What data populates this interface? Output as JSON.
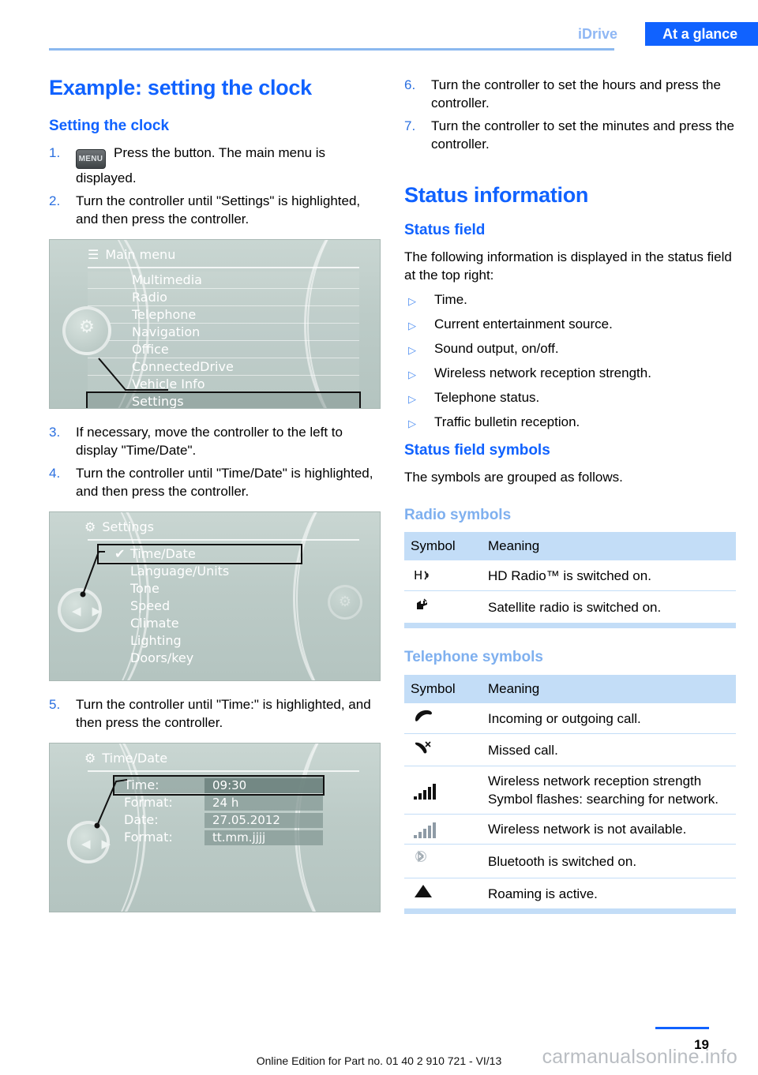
{
  "header": {
    "breadcrumb_previous": "iDrive",
    "breadcrumb_active": "At a glance",
    "accent_blue": "#1062ff",
    "pale_blue": "#8fb7f4"
  },
  "left_column": {
    "title": "Example: setting the clock",
    "section_heading": "Setting the clock",
    "steps": [
      {
        "num": "1.",
        "icon": "MENU",
        "text": "Press the button. The main menu is displayed."
      },
      {
        "num": "2.",
        "text": "Turn the controller until \"Settings\" is highlighted, and then press the controller."
      },
      {
        "num": "3.",
        "text": "If necessary, move the controller to the left to display \"Time/Date\"."
      },
      {
        "num": "4.",
        "text": "Turn the controller until \"Time/Date\" is highlighted, and then press the controller."
      },
      {
        "num": "5.",
        "text": "Turn the controller until \"Time:\" is highlighted, and then press the controller."
      }
    ],
    "screen_main_menu": {
      "title": "Main menu",
      "header_icon": "list-icon",
      "knob_icon": "gear-icon",
      "items": [
        {
          "label": "Multimedia",
          "selected": false
        },
        {
          "label": "Radio",
          "selected": false
        },
        {
          "label": "Telephone",
          "selected": false
        },
        {
          "label": "Navigation",
          "selected": false
        },
        {
          "label": "Office",
          "selected": false
        },
        {
          "label": "ConnectedDrive",
          "selected": false
        },
        {
          "label": "Vehicle Info",
          "selected": false
        },
        {
          "label": "Settings",
          "selected": true
        }
      ]
    },
    "screen_settings": {
      "title": "Settings",
      "header_icon": "gear-icon",
      "knob_icon": "left-right-arrows",
      "items": [
        {
          "label": "Time/Date",
          "selected": true,
          "check": "✔"
        },
        {
          "label": "Language/Units",
          "selected": false
        },
        {
          "label": "Tone",
          "selected": false
        },
        {
          "label": "Speed",
          "selected": false
        },
        {
          "label": "Climate",
          "selected": false
        },
        {
          "label": "Lighting",
          "selected": false
        },
        {
          "label": "Doors/key",
          "selected": false
        }
      ]
    },
    "screen_time_date": {
      "title": "Time/Date",
      "header_icon": "gear-icon",
      "knob_icon": "left-right-arrows",
      "rows": [
        {
          "label": "Time:",
          "value": "09:30",
          "selected": true
        },
        {
          "label": "Format:",
          "value": "24 h",
          "selected": false
        },
        {
          "label": "Date:",
          "value": "27.05.2012",
          "selected": false
        },
        {
          "label": "Format:",
          "value": "tt.mm.jjjj",
          "selected": false
        }
      ]
    }
  },
  "right_column": {
    "steps": [
      {
        "num": "6.",
        "text": "Turn the controller to set the hours and press the controller."
      },
      {
        "num": "7.",
        "text": "Turn the controller to set the minutes and press the controller."
      }
    ],
    "title": "Status information",
    "status_field_heading": "Status field",
    "status_field_intro": "The following information is displayed in the status field at the top right:",
    "status_field_bullets": [
      "Time.",
      "Current entertainment source.",
      "Sound output, on/off.",
      "Wireless network reception strength.",
      "Telephone status.",
      "Traffic bulletin reception."
    ],
    "symbols_heading": "Status field symbols",
    "symbols_intro": "The symbols are grouped as follows.",
    "radio_symbols": {
      "heading": "Radio symbols",
      "columns": [
        "Symbol",
        "Meaning"
      ],
      "rows": [
        {
          "symbol": "hd-radio-icon",
          "glyph": "H⟩",
          "meaning": "HD Radio™ is switched on."
        },
        {
          "symbol": "satellite-radio-icon",
          "glyph": "",
          "meaning": "Satellite radio is switched on."
        }
      ]
    },
    "telephone_symbols": {
      "heading": "Telephone symbols",
      "columns": [
        "Symbol",
        "Meaning"
      ],
      "rows": [
        {
          "symbol": "phone-handset-icon",
          "glyph": "",
          "meaning": "Incoming or outgoing call."
        },
        {
          "symbol": "missed-call-icon",
          "glyph": "",
          "meaning": "Missed call."
        },
        {
          "symbol": "signal-bars-icon",
          "glyph": "",
          "meaning": "Wireless network reception strength Symbol flashes: searching for network."
        },
        {
          "symbol": "signal-bars-grey-icon",
          "glyph": "",
          "meaning": "Wireless network is not available."
        },
        {
          "symbol": "bluetooth-icon",
          "glyph": "",
          "meaning": "Bluetooth is switched on."
        },
        {
          "symbol": "roaming-triangle-icon",
          "glyph": "▲",
          "meaning": "Roaming is active."
        }
      ]
    }
  },
  "footer": {
    "edition_text": "Online Edition for Part no. 01 40 2 910 721 - VI/13",
    "page_number": "19",
    "watermark": "carmanualsonline.info"
  }
}
